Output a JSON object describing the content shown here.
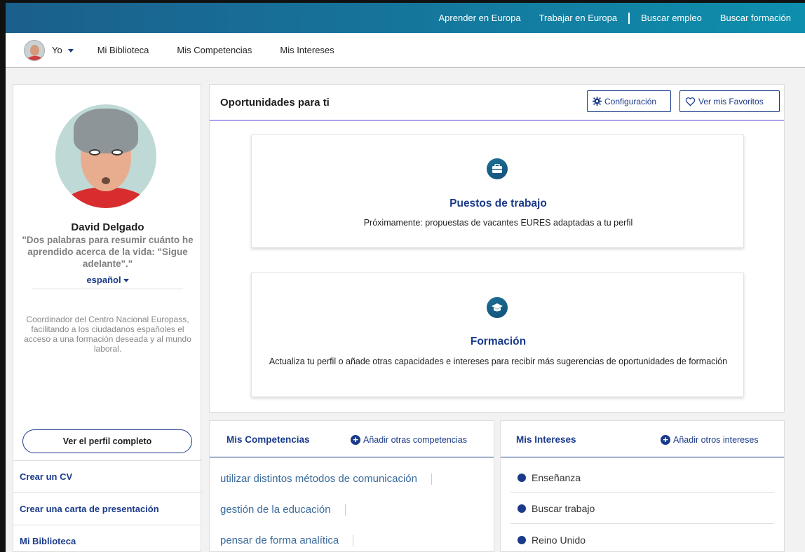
{
  "topbar": {
    "links": [
      "Aprender en Europa",
      "Trabajar en Europa",
      "Buscar empleo",
      "Buscar formación"
    ]
  },
  "subnav": {
    "user_label": "Yo",
    "links": [
      "Mi Biblioteca",
      "Mis Competencias",
      "Mis Intereses"
    ]
  },
  "profile": {
    "name": "David Delgado",
    "quote": "\"Dos palabras para resumir cuánto he aprendido acerca de la vida: \"Sigue adelante\".\"",
    "language": "español",
    "description": "Coordinador del Centro Nacional Europass, facilitando a los ciudadanos españoles el acceso a una formación deseada y al mundo laboral.",
    "view_profile_button": "Ver el perfil completo",
    "links": [
      "Crear un CV",
      "Crear una carta de presentación",
      "Mi Biblioteca"
    ]
  },
  "opportunities": {
    "title": "Oportunidades para ti",
    "config_button": "Configuración",
    "favorites_button": "Ver mis Favoritos",
    "cards": [
      {
        "icon": "briefcase-icon",
        "title": "Puestos de trabajo",
        "text": "Próximamente: propuestas de vacantes EURES adaptadas a tu perfil"
      },
      {
        "icon": "graduation-cap-icon",
        "title": "Formación",
        "text": "Actualiza tu perfil o añade otras capacidades e intereses para recibir más sugerencias de oportunidades de formación"
      }
    ]
  },
  "competencias": {
    "title": "Mis Competencias",
    "add_label": "Añadir otras competencias",
    "items": [
      "utilizar distintos métodos de comunicación",
      "gestión de la educación",
      "pensar de forma analítica"
    ]
  },
  "intereses": {
    "title": "Mis Intereses",
    "add_label": "Añadir otros intereses",
    "items": [
      "Enseñanza",
      "Buscar trabajo",
      "Reino Unido"
    ]
  },
  "colors": {
    "primary": "#1a3a8a",
    "topbar_start": "#1b5f8c",
    "topbar_end": "#0e8fad",
    "accent_line": "#5d3fd3"
  }
}
